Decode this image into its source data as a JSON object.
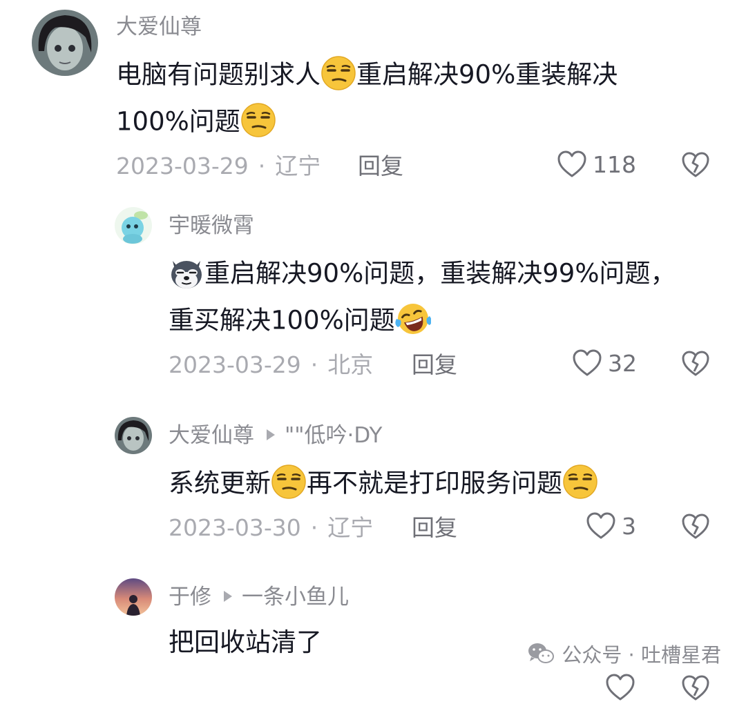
{
  "comments": [
    {
      "username": "大爱仙尊",
      "text_parts": [
        "电脑有问题别求人",
        "重启解决90%重装解决",
        "100%问题"
      ],
      "date": "2023-03-29",
      "location": "辽宁",
      "reply_label": "回复",
      "likes": "118"
    },
    {
      "username": "宇暖微霄",
      "text_parts": [
        "重启解决90%问题，重装解决99%问题，",
        "重买解决100%问题"
      ],
      "date": "2023-03-29",
      "location": "北京",
      "reply_label": "回复",
      "likes": "32"
    },
    {
      "username": "大爱仙尊",
      "reply_to": "\"\"低吟·DY",
      "text_parts": [
        "系统更新",
        "再不就是打印服务问题"
      ],
      "date": "2023-03-30",
      "location": "辽宁",
      "reply_label": "回复",
      "likes": "3"
    },
    {
      "username": "于修",
      "reply_to": "一条小鱼儿",
      "text_parts": [
        "把回收站清了"
      ]
    }
  ],
  "separator": "·",
  "watermark": "公众号 · 吐槽星君",
  "colors": {
    "primary_text": "#161823",
    "secondary_text": "#8a8b91",
    "meta_text": "#a9aab0",
    "emoji_yellow": "#f7c53b"
  },
  "icons": [
    "heart-outline-icon",
    "broken-heart-icon",
    "smirk-emoji-icon",
    "husky-emoji-icon",
    "laughing-tears-emoji-icon",
    "wechat-icon"
  ]
}
